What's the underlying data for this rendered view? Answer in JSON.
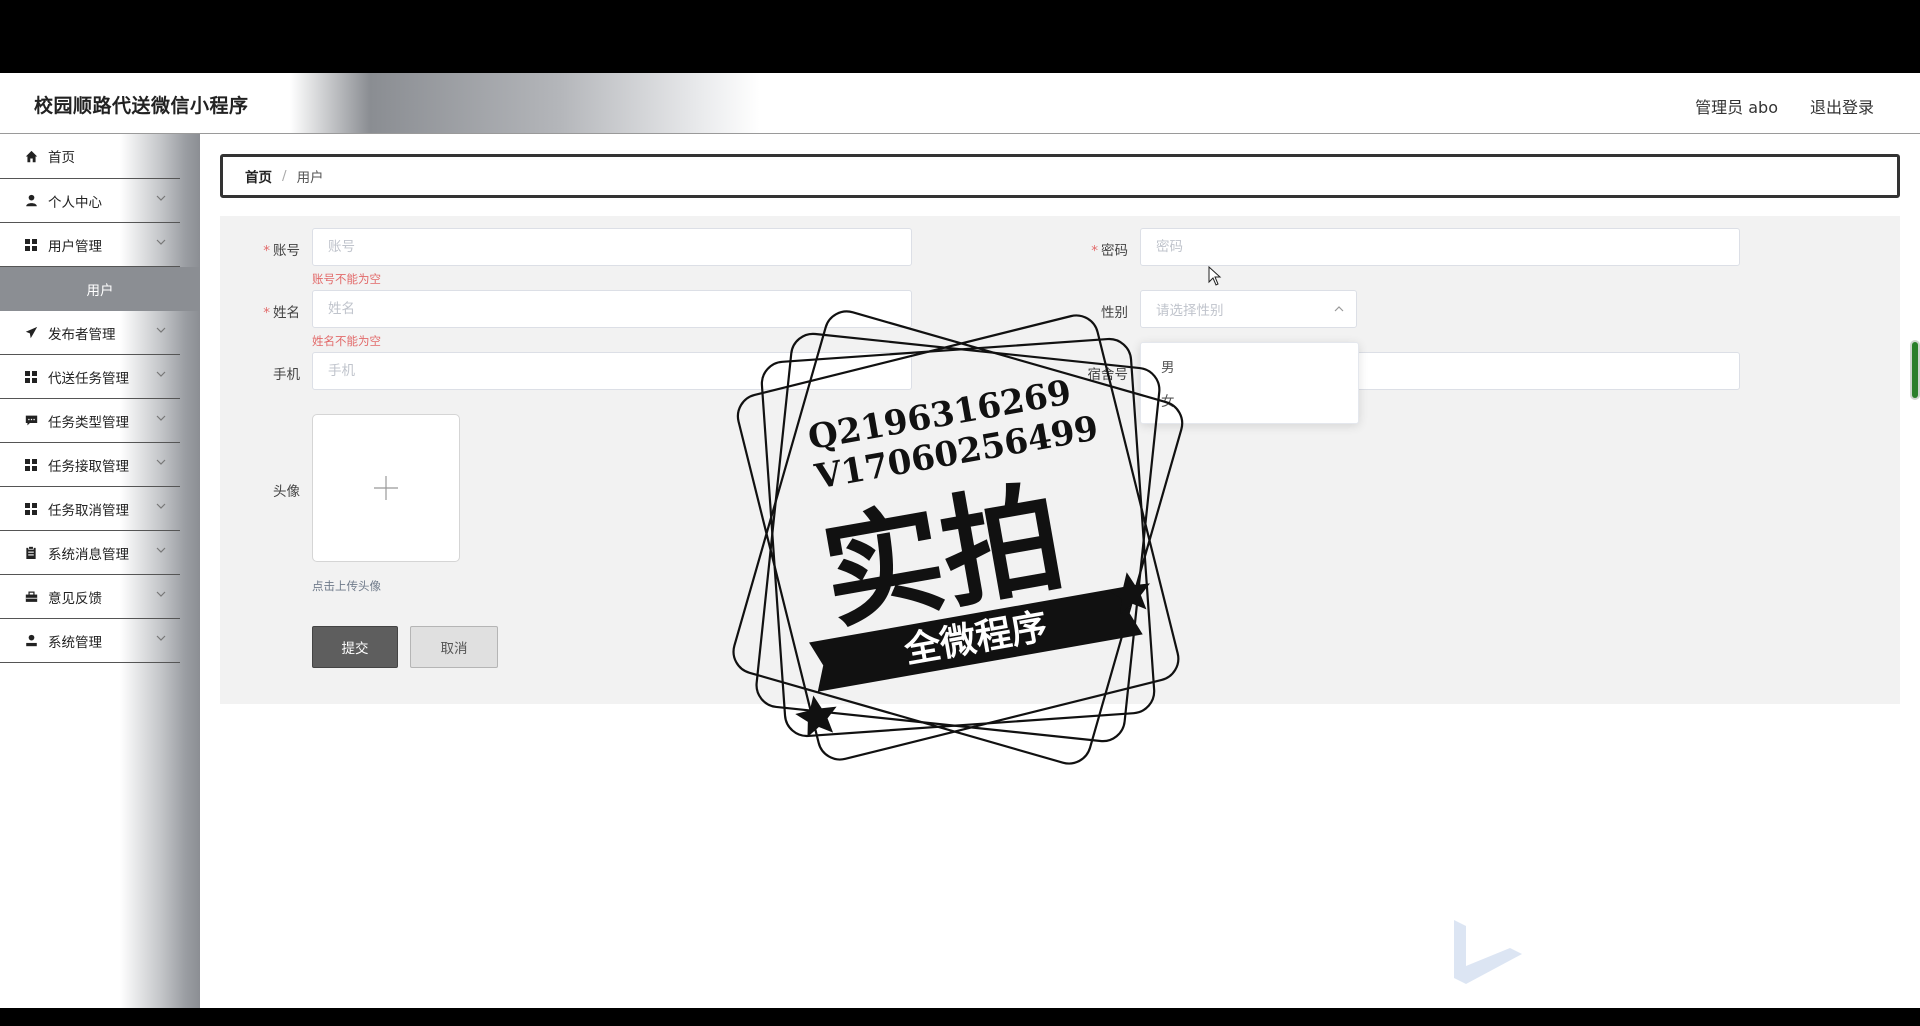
{
  "app": {
    "title": "校园顺路代送微信小程序",
    "user_label": "管理员 abo",
    "logout_label": "退出登录"
  },
  "sidebar": {
    "items": [
      {
        "label": "首页",
        "icon": "home-icon"
      },
      {
        "label": "个人中心",
        "icon": "user-icon"
      },
      {
        "label": "用户管理",
        "icon": "grid-icon"
      },
      {
        "label": "用户",
        "sub": true
      },
      {
        "label": "发布者管理",
        "icon": "send-icon"
      },
      {
        "label": "代送任务管理",
        "icon": "grid-icon"
      },
      {
        "label": "任务类型管理",
        "icon": "chat-icon"
      },
      {
        "label": "任务接取管理",
        "icon": "grid-icon"
      },
      {
        "label": "任务取消管理",
        "icon": "grid-icon"
      },
      {
        "label": "系统消息管理",
        "icon": "clipboard-icon"
      },
      {
        "label": "意见反馈",
        "icon": "briefcase-icon"
      },
      {
        "label": "系统管理",
        "icon": "admin-icon"
      }
    ]
  },
  "breadcrumb": {
    "home": "首页",
    "separator": "/",
    "current": "用户"
  },
  "form": {
    "account": {
      "label": "账号",
      "placeholder": "账号",
      "error": "账号不能为空"
    },
    "password": {
      "label": "密码",
      "placeholder": "密码"
    },
    "name": {
      "label": "姓名",
      "placeholder": "姓名",
      "error": "姓名不能为空"
    },
    "gender": {
      "label": "性别",
      "placeholder": "请选择性别",
      "options": [
        "男",
        "女"
      ]
    },
    "phone": {
      "label": "手机",
      "placeholder": "手机"
    },
    "dorm": {
      "label": "宿舍号"
    },
    "avatar": {
      "label": "头像",
      "tip": "点击上传头像"
    },
    "required_mark": "*",
    "submit_label": "提交",
    "cancel_label": "取消"
  },
  "watermark": {
    "line1": "Q2196316269",
    "line2": "V17060256499",
    "main": "实拍",
    "banner": "全微程序"
  },
  "colors": {
    "error": "#e26a6a",
    "sidebar_active": "#8b8e93",
    "submit_bg": "#5e5e5e"
  }
}
